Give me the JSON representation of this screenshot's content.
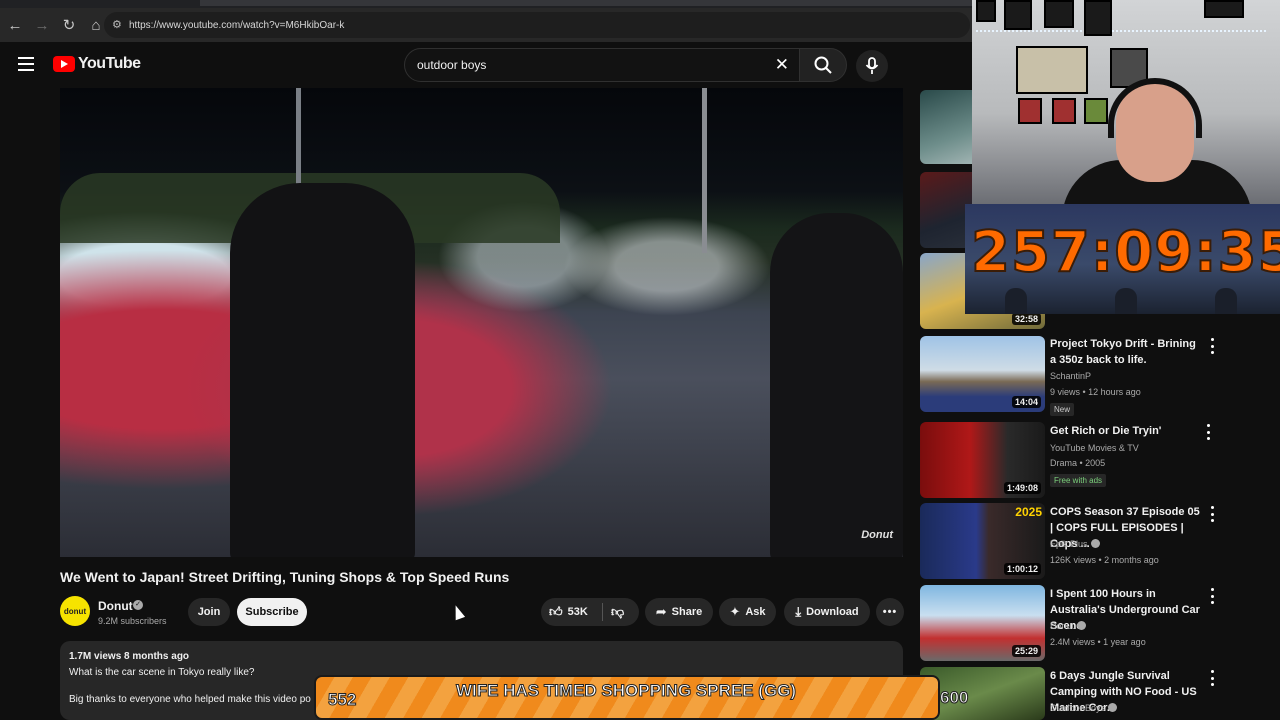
{
  "browser": {
    "url": "https://www.youtube.com/watch?v=M6HkibOar-k",
    "icons": [
      "back-arrow-icon",
      "forward-arrow-icon",
      "reload-icon",
      "home-icon",
      "site-info-icon"
    ]
  },
  "header": {
    "logo_text": "YouTube",
    "search_value": "outdoor boys",
    "accent": "#ff0000"
  },
  "video": {
    "watermark": "Donut",
    "title": "We Went to Japan! Street Drifting, Tuning Shops & Top Speed Runs"
  },
  "channel": {
    "name": "Donut",
    "subscribers": "9.2M subscribers",
    "join_label": "Join",
    "subscribe_label": "Subscribe"
  },
  "actions": {
    "likes": "53K",
    "share_label": "Share",
    "ask_label": "Ask",
    "download_label": "Download"
  },
  "description": {
    "meta": "1.7M views  8 months ago",
    "line1": "What is the car scene in Tokyo really like?",
    "line2": "Big thanks to everyone who helped make this video po"
  },
  "recommendations": [
    {
      "duration": ""
    },
    {
      "duration": ""
    },
    {
      "duration": "32:58"
    },
    {
      "title": "Project Tokyo Drift - Brining a 350z back to life.",
      "channel": "SchantinP",
      "meta": "9 views • 12 hours ago",
      "badge": "New",
      "duration": "14:04"
    },
    {
      "title": "Get Rich or Die Tryin'",
      "channel": "YouTube Movies & TV",
      "meta": "Drama • 2005",
      "badge": "Free with ads",
      "duration": "1:49:08"
    },
    {
      "title": "COPS Season 37 Episode 05 | COPS FULL EPISODES | Cops ...",
      "channel": "Epik Plus",
      "meta": "126K views • 2 months ago",
      "duration": "1:00:12",
      "thumb_text": "2025"
    },
    {
      "title": "I Spent 100 Hours in Australia's Underground Car Scene",
      "channel": "Donut",
      "meta": "2.4M views • 1 year ago",
      "duration": "25:29"
    },
    {
      "title": "6 Days Jungle Survival Camping with NO Food - US Marine Cor...",
      "channel": "Outdoor Boys"
    }
  ],
  "overlays": {
    "timer": "257:09:35",
    "banner_left": "552",
    "banner_text": "WIFE HAS TIMED SHOPPING SPREE (GG)",
    "banner_right": "600",
    "timer_color": "#ff6a00",
    "banner_color": "#f08a1c"
  }
}
